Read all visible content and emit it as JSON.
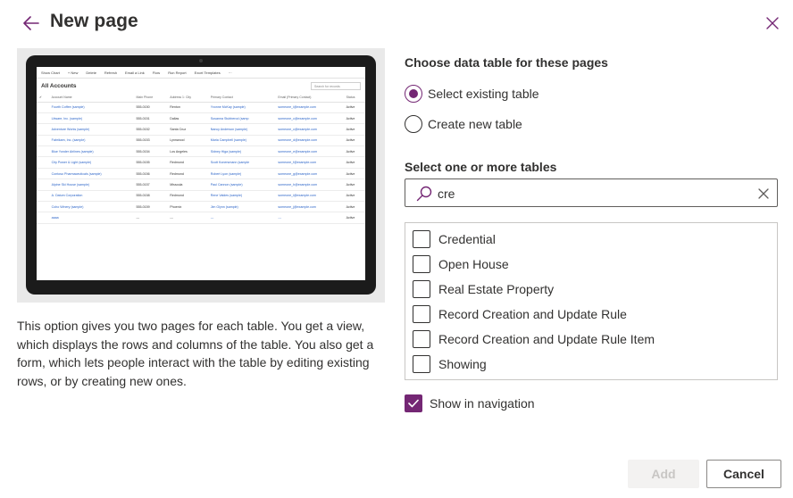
{
  "header": {
    "title": "New page"
  },
  "preview": {
    "toolbar": [
      "Show Chart",
      "+ New",
      "Delete",
      "Refresh",
      "Email a Link",
      "Flow",
      "Run Report",
      "Excel Templates",
      "···"
    ],
    "view_title": "All Accounts",
    "search_placeholder": "Search for records",
    "columns": [
      "✔",
      "Account Name",
      "Main Phone",
      "Address 1: City",
      "Primary Contact",
      "Email (Primary Contact)",
      "Status"
    ],
    "rows": [
      [
        "Fourth Coffee (sample)",
        "555-0150",
        "Renton",
        "Yvonne McKay (sample)",
        "someone_i@example.com",
        "Active"
      ],
      [
        "Litware, Inc. (sample)",
        "555-0151",
        "Dallas",
        "Susanna Stubberod (samp",
        "someone_c@example.com",
        "Active"
      ],
      [
        "Adventure Works (sample)",
        "555-0152",
        "Santa Cruz",
        "Nancy Anderson (sample)",
        "someone_c@example.com",
        "Active"
      ],
      [
        "Fabrikam, Inc. (sample)",
        "555-0153",
        "Lynnwood",
        "Maria Campbell (sample)",
        "someone_d@example.com",
        "Active"
      ],
      [
        "Blue Yonder Airlines (sample)",
        "555-0154",
        "Los Angeles",
        "Sidney Higa (sample)",
        "someone_e@example.com",
        "Active"
      ],
      [
        "City Power & Light (sample)",
        "555-0155",
        "Redmond",
        "Scott Konersmann (sample",
        "someone_f@example.com",
        "Active"
      ],
      [
        "Contoso Pharmaceuticals (sample)",
        "555-0156",
        "Redmond",
        "Robert Lyon (sample)",
        "someone_g@example.com",
        "Active"
      ],
      [
        "Alpine Ski House (sample)",
        "555-0157",
        "Missoula",
        "Paul Cannon (sample)",
        "someone_h@example.com",
        "Active"
      ],
      [
        "A. Datum Corporation",
        "555-0158",
        "Redmond",
        "Rene Valdes (sample)",
        "someone_i@example.com",
        "Active"
      ],
      [
        "Coho Winery (sample)",
        "555-0159",
        "Phoenix",
        "Jim Glynn (sample)",
        "someone_j@example.com",
        "Active"
      ],
      [
        "aaaa",
        "---",
        "---",
        "---",
        "---",
        "Active"
      ]
    ]
  },
  "description": "This option gives you two pages for each table. You get a view, which displays the rows and columns of the table. You also get a form, which lets people interact with the table by editing existing rows, or by creating new ones.",
  "data_table": {
    "heading": "Choose data table for these pages",
    "options": [
      {
        "label": "Select existing table",
        "selected": true
      },
      {
        "label": "Create new table",
        "selected": false
      }
    ]
  },
  "tables": {
    "heading": "Select one or more tables",
    "search_value": "cre",
    "items": [
      {
        "label": "Credential",
        "checked": false
      },
      {
        "label": "Open House",
        "checked": false
      },
      {
        "label": "Real Estate Property",
        "checked": false
      },
      {
        "label": "Record Creation and Update Rule",
        "checked": false
      },
      {
        "label": "Record Creation and Update Rule Item",
        "checked": false
      },
      {
        "label": "Showing",
        "checked": false
      }
    ]
  },
  "navigation": {
    "label": "Show in navigation",
    "checked": true
  },
  "footer": {
    "add_label": "Add",
    "cancel_label": "Cancel"
  },
  "colors": {
    "accent": "#742774",
    "text": "#323130",
    "border": "#8a8886",
    "disabled_bg": "#f3f2f1",
    "disabled_text": "#c8c6c4"
  }
}
